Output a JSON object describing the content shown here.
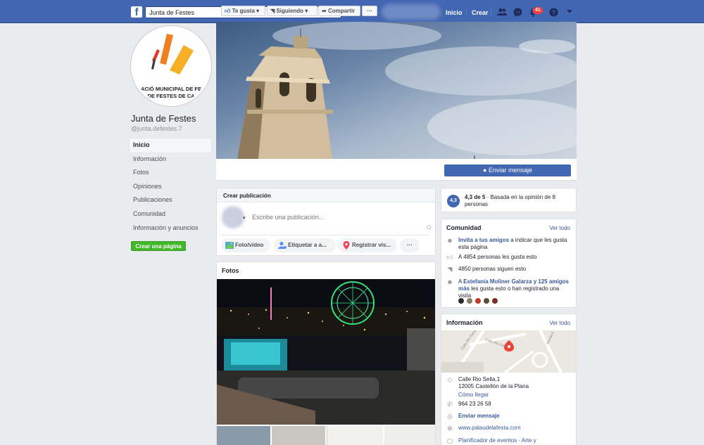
{
  "topbar": {
    "search_value": "Junta de Festes",
    "nav_home": "Inicio",
    "nav_create": "Crear",
    "notifications_count": "41"
  },
  "page": {
    "name": "Junta de Festes",
    "handle": "@junta.defestes.7",
    "logo_line1": "ACIÓ MUNICIPAL DE FE",
    "logo_line2": "DE FESTES DE CA"
  },
  "leftnav": {
    "items": [
      "Inicio",
      "Información",
      "Fotos",
      "Opiniones",
      "Publicaciones",
      "Comunidad",
      "Información y anuncios"
    ],
    "create_page": "Crear una página"
  },
  "actions": {
    "like": "Te gusta",
    "following": "Siguiendo",
    "share": "Compartir",
    "more": "···",
    "send_message": "Enviar mensaje"
  },
  "composer": {
    "title": "Crear publicación",
    "placeholder": "Escribe una publicación...",
    "photo": "Foto/vídeo",
    "tag": "Etiquetar a a...",
    "checkin": "Registrar vis...",
    "more": "···"
  },
  "photos": {
    "title": "Fotos"
  },
  "rating": {
    "score": "4,3",
    "text_bold": "4,3 de 5",
    "text_rest": " · Basada en la opinión de 8 personas"
  },
  "community": {
    "title": "Comunidad",
    "see_all": "Ver todo",
    "invite_link": "Invita a tus amigos",
    "invite_rest": " a indicar que les gusta esta página",
    "likes": "A 4854 personas les gusta esto",
    "follows": "4850 personas siguen esto",
    "friends_prefix": "A ",
    "friends_link": "Estefanía Moliner Galarza y 125 amigos más",
    "friends_rest": " les gusta esto o han registrado una visita"
  },
  "info": {
    "title": "Información",
    "see_all": "Ver todo",
    "address_line1": "Calle Rio Sella,1",
    "address_line2": "12005 Castellón de la Plana",
    "directions": "Cómo llegar",
    "phone": "964 23 26 58",
    "send_message": "Enviar mensaje",
    "website": "www.palaudelafesta.com",
    "category": "Planificador de eventos · Arte y",
    "map_street1": "Calle Rio Danubio",
    "map_street2": "Calle Río Danubio",
    "map_street3": "Ronda E"
  },
  "colors": {
    "brand": "#4267b2",
    "link": "#385898",
    "green": "#42b72a",
    "badge": "#fa3e3e"
  }
}
